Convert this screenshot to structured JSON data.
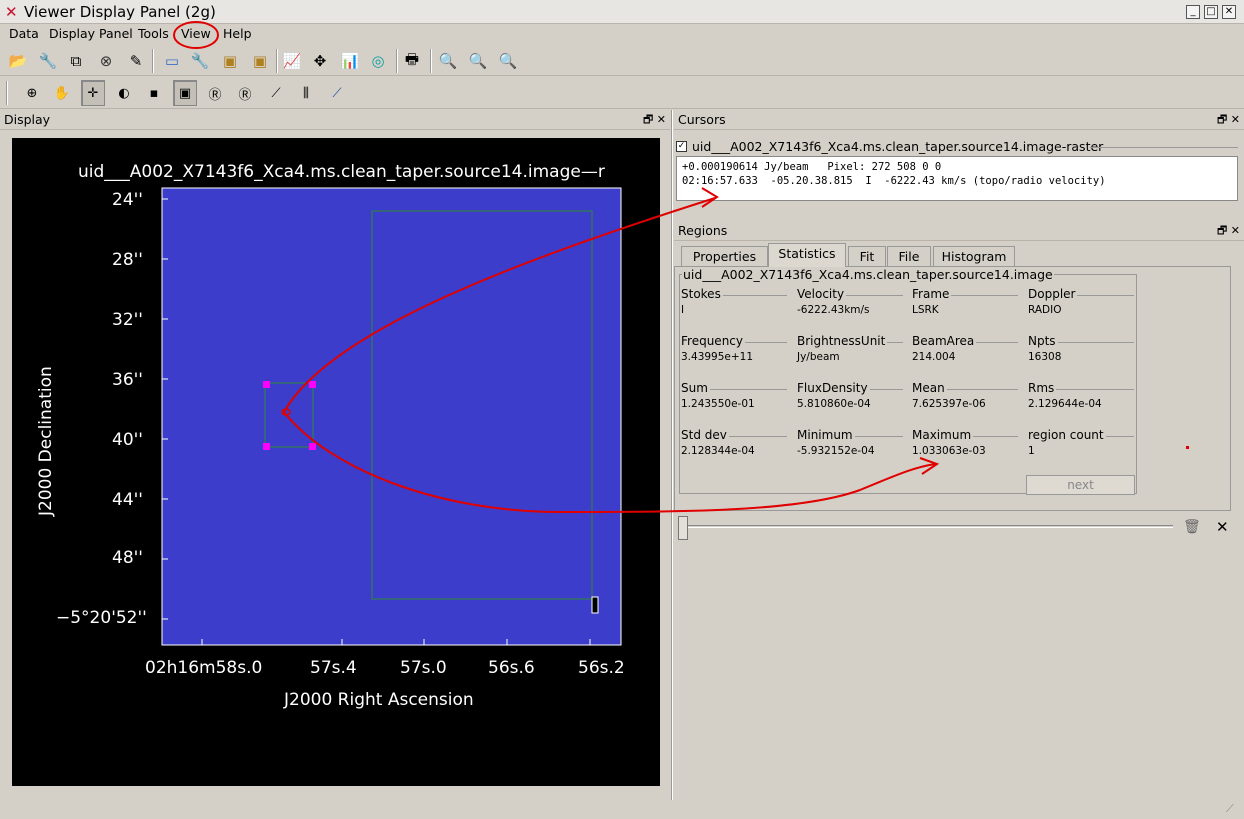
{
  "window": {
    "title": "Viewer Display Panel (2g)",
    "logo_icon": "x-logo-icon"
  },
  "menu": [
    {
      "label": "Data"
    },
    {
      "label": "Display Panel"
    },
    {
      "label": "Tools"
    },
    {
      "label": "View"
    },
    {
      "label": "Help"
    }
  ],
  "display_dock": {
    "title": "Display"
  },
  "image": {
    "title": "uid___A002_X7143f6_Xca4.ms.clean_taper.source14.image—r",
    "dec_ticks": [
      "24''",
      "28''",
      "32''",
      "36''",
      "40''",
      "44''",
      "48''",
      "−5°20'52''"
    ],
    "ra_ticks": [
      "02h16m58s.0",
      "57s.4",
      "57s.0",
      "56s.6",
      "56s.2"
    ],
    "xlabel": "J2000 Right Ascension",
    "ylabel": "J2000 Declination"
  },
  "cursors_dock": {
    "title": "Cursors",
    "layer_checked": true,
    "layer_name": "uid___A002_X7143f6_Xca4.ms.clean_taper.source14.image-raster",
    "line1": "+0.000190614 Jy/beam   Pixel: 272 508 0 0",
    "line2": "02:16:57.633  -05.20.38.815  I  -6222.43 km/s (topo/radio velocity)"
  },
  "regions_dock": {
    "title": "Regions",
    "tabs": [
      "Properties",
      "Statistics",
      "Fit",
      "File",
      "Histogram"
    ],
    "active_tab": "Statistics",
    "group_title": "uid___A002_X7143f6_Xca4.ms.clean_taper.source14.image",
    "stats": [
      {
        "label": "Stokes",
        "value": "I"
      },
      {
        "label": "Velocity",
        "value": "-6222.43km/s"
      },
      {
        "label": "Frame",
        "value": "LSRK"
      },
      {
        "label": "Doppler",
        "value": "RADIO"
      },
      {
        "label": "Frequency",
        "value": "3.43995e+11"
      },
      {
        "label": "BrightnessUnit",
        "value": "Jy/beam"
      },
      {
        "label": "BeamArea",
        "value": "214.004"
      },
      {
        "label": "Npts",
        "value": "16308"
      },
      {
        "label": "Sum",
        "value": "1.243550e-01"
      },
      {
        "label": "FluxDensity",
        "value": "5.810860e-04"
      },
      {
        "label": "Mean",
        "value": "7.625397e-06"
      },
      {
        "label": "Rms",
        "value": "2.129644e-04"
      },
      {
        "label": "Std dev",
        "value": "2.128344e-04"
      },
      {
        "label": "Minimum",
        "value": "-5.932152e-04"
      },
      {
        "label": "Maximum",
        "value": "1.033063e-03"
      },
      {
        "label": "region count",
        "value": "1"
      }
    ],
    "next_label": "next"
  },
  "colors": {
    "annotation_red": "#e00000",
    "region_magenta": "#ff00ff",
    "region_green": "#2e8b2e"
  }
}
